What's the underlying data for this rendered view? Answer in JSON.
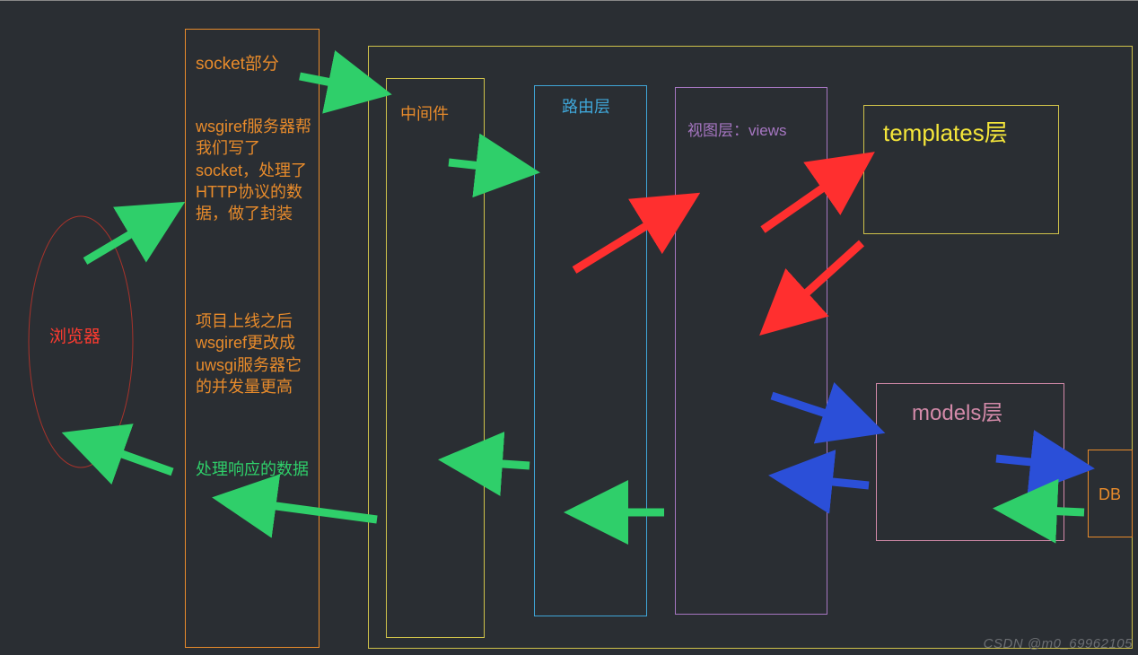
{
  "browser": {
    "label": "浏览器",
    "color": "#ff3b30"
  },
  "socket_box": {
    "title": "socket部分",
    "desc1": "wsgiref服务器帮我们写了socket，处理了HTTP协议的数据，做了封装",
    "desc2": "项目上线之后wsgiref更改成uwsgi服务器它的并发量更高",
    "border": "#e88b2b",
    "text_color": "#e88b2b"
  },
  "response": {
    "label": "处理响应的数据",
    "color": "#2fcf6a"
  },
  "outer_yellow": {
    "border": "#cfc24a"
  },
  "middleware": {
    "label": "中间件",
    "border": "#cfc24a",
    "text_color": "#e88b2b"
  },
  "router": {
    "label": "路由层",
    "border": "#3fa6d8",
    "text_color": "#3fa6d8"
  },
  "views": {
    "label": "视图层：views",
    "border": "#a676c2",
    "text_color": "#a676c2"
  },
  "templates": {
    "label": "templates层",
    "border": "#cfc24a",
    "text_color": "#f5e63a"
  },
  "models": {
    "label": "models层",
    "border": "#d38aa9",
    "text_color": "#d38aa9"
  },
  "db": {
    "label": "DB",
    "border": "#e88b2b",
    "text_color": "#e88b2b"
  },
  "watermark": "CSDN @m0_69962105",
  "colors": {
    "green": "#2fcf6a",
    "red": "#ff2f2f",
    "blue": "#2b4fd8"
  }
}
